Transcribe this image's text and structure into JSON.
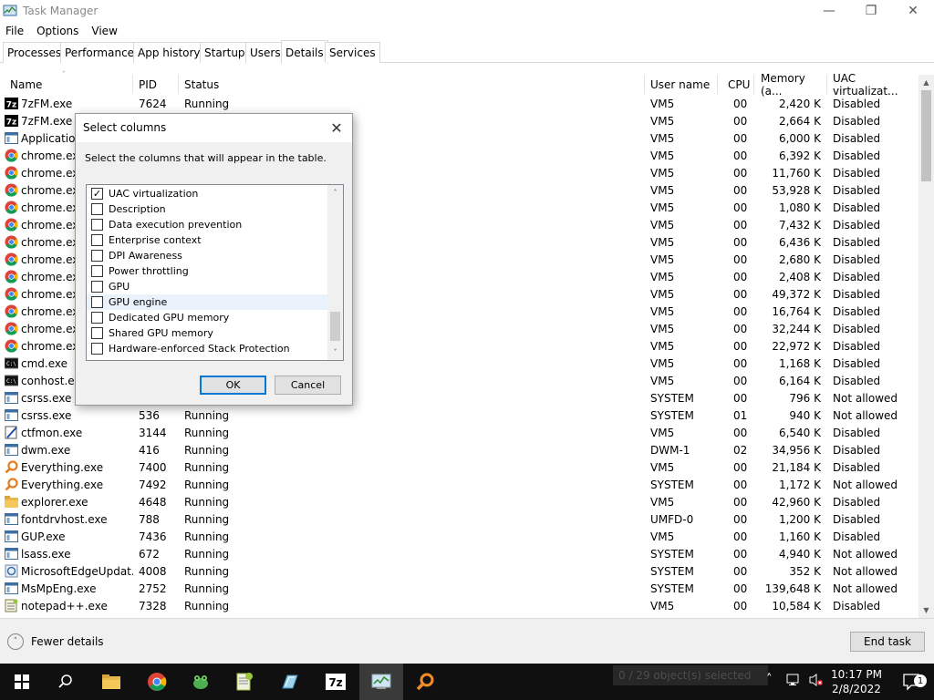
{
  "window": {
    "title": "Task Manager"
  },
  "menu": [
    "File",
    "Options",
    "View"
  ],
  "tabs": [
    "Processes",
    "Performance",
    "App history",
    "Startup",
    "Users",
    "Details",
    "Services"
  ],
  "active_tab": "Details",
  "columns": [
    "Name",
    "PID",
    "Status",
    "User name",
    "CPU",
    "Memory (a...",
    "UAC virtualizat..."
  ],
  "rows": [
    {
      "name": "7zFM.exe",
      "pid": "7624",
      "status": "Running",
      "user": "VM5",
      "cpu": "00",
      "mem": "2,420 K",
      "uac": "Disabled",
      "icon": "7zip-icon"
    },
    {
      "name": "7zFM.exe",
      "pid": "",
      "status": "",
      "user": "VM5",
      "cpu": "00",
      "mem": "2,664 K",
      "uac": "Disabled",
      "icon": "7zip-icon"
    },
    {
      "name": "Application",
      "pid": "",
      "status": "",
      "user": "VM5",
      "cpu": "00",
      "mem": "6,000 K",
      "uac": "Disabled",
      "icon": "app-window-icon"
    },
    {
      "name": "chrome.exe",
      "pid": "",
      "status": "",
      "user": "VM5",
      "cpu": "00",
      "mem": "6,392 K",
      "uac": "Disabled",
      "icon": "chrome-icon"
    },
    {
      "name": "chrome.exe",
      "pid": "",
      "status": "",
      "user": "VM5",
      "cpu": "00",
      "mem": "11,760 K",
      "uac": "Disabled",
      "icon": "chrome-icon"
    },
    {
      "name": "chrome.exe",
      "pid": "",
      "status": "",
      "user": "VM5",
      "cpu": "00",
      "mem": "53,928 K",
      "uac": "Disabled",
      "icon": "chrome-icon"
    },
    {
      "name": "chrome.exe",
      "pid": "",
      "status": "",
      "user": "VM5",
      "cpu": "00",
      "mem": "1,080 K",
      "uac": "Disabled",
      "icon": "chrome-icon"
    },
    {
      "name": "chrome.exe",
      "pid": "",
      "status": "",
      "user": "VM5",
      "cpu": "00",
      "mem": "7,432 K",
      "uac": "Disabled",
      "icon": "chrome-icon"
    },
    {
      "name": "chrome.exe",
      "pid": "",
      "status": "",
      "user": "VM5",
      "cpu": "00",
      "mem": "6,436 K",
      "uac": "Disabled",
      "icon": "chrome-icon"
    },
    {
      "name": "chrome.exe",
      "pid": "",
      "status": "",
      "user": "VM5",
      "cpu": "00",
      "mem": "2,680 K",
      "uac": "Disabled",
      "icon": "chrome-icon"
    },
    {
      "name": "chrome.exe",
      "pid": "",
      "status": "",
      "user": "VM5",
      "cpu": "00",
      "mem": "2,408 K",
      "uac": "Disabled",
      "icon": "chrome-icon"
    },
    {
      "name": "chrome.exe",
      "pid": "",
      "status": "",
      "user": "VM5",
      "cpu": "00",
      "mem": "49,372 K",
      "uac": "Disabled",
      "icon": "chrome-icon"
    },
    {
      "name": "chrome.exe",
      "pid": "",
      "status": "",
      "user": "VM5",
      "cpu": "00",
      "mem": "16,764 K",
      "uac": "Disabled",
      "icon": "chrome-icon"
    },
    {
      "name": "chrome.exe",
      "pid": "",
      "status": "",
      "user": "VM5",
      "cpu": "00",
      "mem": "32,244 K",
      "uac": "Disabled",
      "icon": "chrome-icon"
    },
    {
      "name": "chrome.exe",
      "pid": "",
      "status": "",
      "user": "VM5",
      "cpu": "00",
      "mem": "22,972 K",
      "uac": "Disabled",
      "icon": "chrome-icon"
    },
    {
      "name": "cmd.exe",
      "pid": "",
      "status": "",
      "user": "VM5",
      "cpu": "00",
      "mem": "1,168 K",
      "uac": "Disabled",
      "icon": "console-icon"
    },
    {
      "name": "conhost.exe",
      "pid": "",
      "status": "",
      "user": "VM5",
      "cpu": "00",
      "mem": "6,164 K",
      "uac": "Disabled",
      "icon": "console-icon"
    },
    {
      "name": "csrss.exe",
      "pid": "",
      "status": "",
      "user": "SYSTEM",
      "cpu": "00",
      "mem": "796 K",
      "uac": "Not allowed",
      "icon": "app-window-icon"
    },
    {
      "name": "csrss.exe",
      "pid": "536",
      "status": "Running",
      "user": "SYSTEM",
      "cpu": "01",
      "mem": "940 K",
      "uac": "Not allowed",
      "icon": "app-window-icon"
    },
    {
      "name": "ctfmon.exe",
      "pid": "3144",
      "status": "Running",
      "user": "VM5",
      "cpu": "00",
      "mem": "6,540 K",
      "uac": "Disabled",
      "icon": "pen-icon"
    },
    {
      "name": "dwm.exe",
      "pid": "416",
      "status": "Running",
      "user": "DWM-1",
      "cpu": "02",
      "mem": "34,956 K",
      "uac": "Disabled",
      "icon": "app-window-icon"
    },
    {
      "name": "Everything.exe",
      "pid": "7400",
      "status": "Running",
      "user": "VM5",
      "cpu": "00",
      "mem": "21,184 K",
      "uac": "Disabled",
      "icon": "magnifier-icon"
    },
    {
      "name": "Everything.exe",
      "pid": "7492",
      "status": "Running",
      "user": "SYSTEM",
      "cpu": "00",
      "mem": "1,172 K",
      "uac": "Not allowed",
      "icon": "magnifier-icon"
    },
    {
      "name": "explorer.exe",
      "pid": "4648",
      "status": "Running",
      "user": "VM5",
      "cpu": "00",
      "mem": "42,960 K",
      "uac": "Disabled",
      "icon": "folder-icon"
    },
    {
      "name": "fontdrvhost.exe",
      "pid": "788",
      "status": "Running",
      "user": "UMFD-0",
      "cpu": "00",
      "mem": "1,200 K",
      "uac": "Disabled",
      "icon": "app-window-icon"
    },
    {
      "name": "GUP.exe",
      "pid": "7436",
      "status": "Running",
      "user": "VM5",
      "cpu": "00",
      "mem": "1,160 K",
      "uac": "Disabled",
      "icon": "app-window-icon"
    },
    {
      "name": "lsass.exe",
      "pid": "672",
      "status": "Running",
      "user": "SYSTEM",
      "cpu": "00",
      "mem": "4,940 K",
      "uac": "Not allowed",
      "icon": "app-window-icon"
    },
    {
      "name": "MicrosoftEdgeUpdat...",
      "pid": "4008",
      "status": "Running",
      "user": "SYSTEM",
      "cpu": "00",
      "mem": "352 K",
      "uac": "Not allowed",
      "icon": "update-icon"
    },
    {
      "name": "MsMpEng.exe",
      "pid": "2752",
      "status": "Running",
      "user": "SYSTEM",
      "cpu": "00",
      "mem": "139,648 K",
      "uac": "Not allowed",
      "icon": "app-window-icon"
    },
    {
      "name": "notepad++.exe",
      "pid": "7328",
      "status": "Running",
      "user": "VM5",
      "cpu": "00",
      "mem": "10,584 K",
      "uac": "Disabled",
      "icon": "notepad-icon"
    }
  ],
  "footer": {
    "fewer_details": "Fewer details",
    "end_task": "End task"
  },
  "dialog": {
    "title": "Select columns",
    "instruction": "Select the columns that will appear in the table.",
    "options": [
      {
        "label": "UAC virtualization",
        "checked": true
      },
      {
        "label": "Description",
        "checked": false
      },
      {
        "label": "Data execution prevention",
        "checked": false
      },
      {
        "label": "Enterprise context",
        "checked": false
      },
      {
        "label": "DPI Awareness",
        "checked": false
      },
      {
        "label": "Power throttling",
        "checked": false
      },
      {
        "label": "GPU",
        "checked": false
      },
      {
        "label": "GPU engine",
        "checked": false,
        "highlighted": true
      },
      {
        "label": "Dedicated GPU memory",
        "checked": false
      },
      {
        "label": "Shared GPU memory",
        "checked": false
      },
      {
        "label": "Hardware-enforced Stack Protection",
        "checked": false
      }
    ],
    "ok": "OK",
    "cancel": "Cancel"
  },
  "taskbar": {
    "status_text": "0 / 29 object(s) selected",
    "time": "10:17 PM",
    "date": "2/8/2022",
    "notification_count": "1",
    "apps": [
      "start-icon",
      "search-icon",
      "file-explorer-icon",
      "chrome-icon",
      "frog-app-icon",
      "notepad-plus-plus-icon",
      "paint-icon",
      "7zip-icon",
      "task-manager-icon",
      "everything-search-icon"
    ]
  },
  "colors": {
    "accent": "#0078d7",
    "taskbar": "#101010",
    "footer": "#f0f0f0"
  }
}
